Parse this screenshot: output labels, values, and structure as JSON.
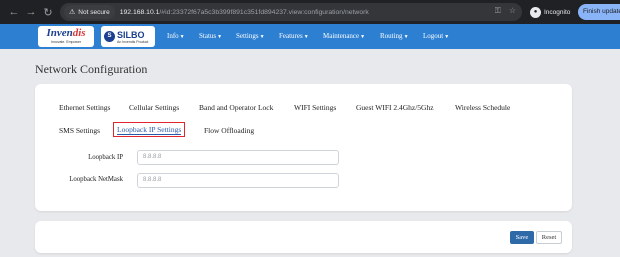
{
  "browser": {
    "security_label": "Not secure",
    "url_host": "192.168.10.1",
    "url_path": "/#id:23372f67a5c3b399f891c351fd894237.view:configuration/network",
    "incognito_label": "Incognito",
    "update_label": "Finish update"
  },
  "brand": {
    "invendis_main": "Inven",
    "invendis_accent": "dis",
    "invendis_tagline": "Innovate. Empower",
    "silbo_name": "SILBO",
    "silbo_tagline": "An Invendis Product"
  },
  "menu": [
    {
      "label": "Info"
    },
    {
      "label": "Status"
    },
    {
      "label": "Settings"
    },
    {
      "label": "Features"
    },
    {
      "label": "Maintenance"
    },
    {
      "label": "Routing"
    },
    {
      "label": "Logout"
    }
  ],
  "page": {
    "title": "Network Configuration"
  },
  "tabs": [
    {
      "label": "Ethernet Settings"
    },
    {
      "label": "Cellular Settings"
    },
    {
      "label": "Band and Operator Lock"
    },
    {
      "label": "WIFI Settings"
    },
    {
      "label": "Guest WIFI 2.4Ghz/5Ghz"
    },
    {
      "label": "Wireless Schedule"
    },
    {
      "label": "SMS Settings"
    },
    {
      "label": "Loopback IP Settings"
    },
    {
      "label": "Flow Offloading"
    }
  ],
  "active_tab": "Loopback IP Settings",
  "form": {
    "loopback_ip": {
      "label": "Loopback IP",
      "placeholder": "8.8.8.8"
    },
    "loopback_netmask": {
      "label": "Loopback NetMask",
      "placeholder": "8.8.8.8"
    }
  },
  "actions": {
    "save": "Save",
    "reset": "Reset"
  },
  "colors": {
    "navbar": "#2d7fd2",
    "highlight": "#e0262c",
    "save_button": "#2e6aa8"
  }
}
